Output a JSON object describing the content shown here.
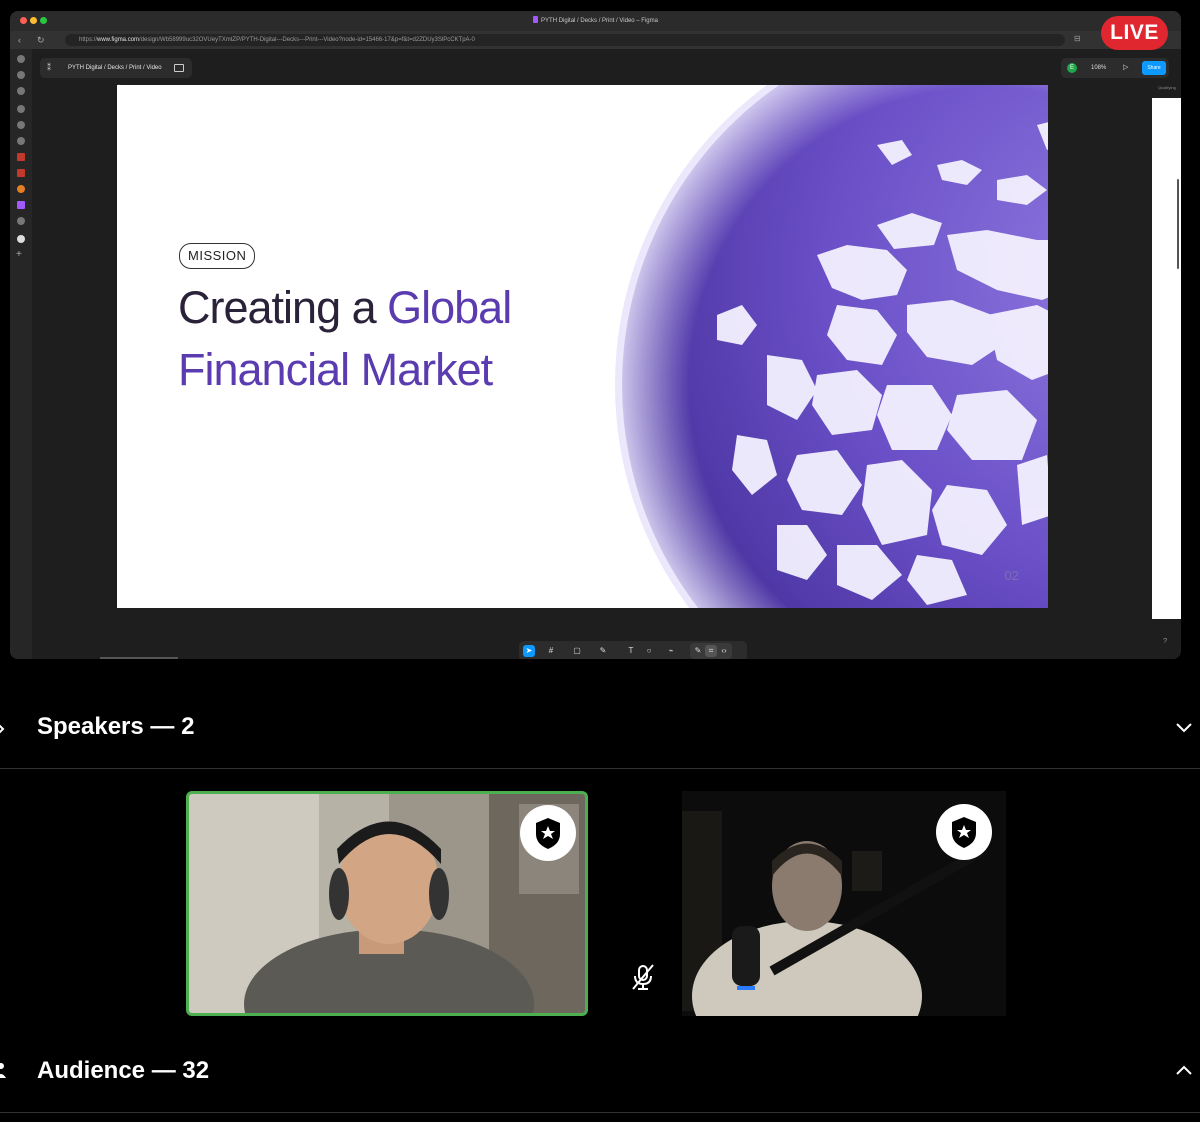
{
  "browser": {
    "window_title": "PYTH Digital / Decks / Print / Video – Figma",
    "url_prefix": "https://",
    "url_domain": "www.figma.com",
    "url_path": "/design/Wb58999uc32OVUeyTXmtZP/PYTH-Digital---Decks---Print---Video?node-id=15466-17&p=f&t=d2ZDUy3SlPcCKTpA-0",
    "live_label": "LIVE"
  },
  "figma": {
    "file_name": "PYTH Digital / Decks / Print / Video",
    "avatar_initial": "E",
    "zoom": "108%",
    "share_label": "Share",
    "frame_label": "Frame",
    "side_frame_label": "Qualifying",
    "help": "?",
    "tools": [
      "move",
      "frame",
      "shape",
      "pen",
      "text",
      "comment",
      "actions",
      "dev-mode"
    ]
  },
  "slide": {
    "tag": "MISSION",
    "headline_line1_dark": "Creating a ",
    "headline_line1_purple": "Global",
    "headline_line2": "Financial Market",
    "page_number": "02",
    "colors": {
      "dark": "#2a2238",
      "purple": "#5b3cb0",
      "globe": "#6a4fc7"
    }
  },
  "spaces": {
    "speakers_heading": "Speakers — 2",
    "audience_heading": "Audience — 32",
    "speaker_count": 2,
    "audience_count": 32,
    "speakers": [
      {
        "active": true,
        "muted": false,
        "badge": "shield-star-icon"
      },
      {
        "active": false,
        "muted": true,
        "badge": "shield-star-icon"
      }
    ]
  }
}
